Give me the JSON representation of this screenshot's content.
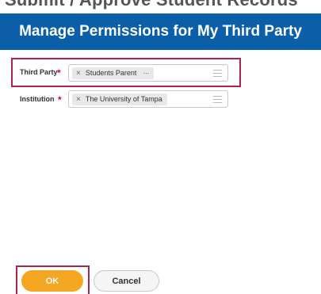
{
  "top_strip_text": "Submit / Approve Student Records",
  "header": {
    "title": "Manage Permissions for My Third Party"
  },
  "fields": [
    {
      "label": "Third Party",
      "required_mark": "*",
      "value": "Students Parent",
      "remove_glyph": "×",
      "more_glyph": "···",
      "icon": "list-icon"
    },
    {
      "label": "Institution",
      "required_mark": "*",
      "value": "The University of Tampa",
      "remove_glyph": "×",
      "icon": "list-icon"
    }
  ],
  "buttons": {
    "ok_label": "OK",
    "cancel_label": "Cancel"
  },
  "colors": {
    "header_bg": "#0a5fa8",
    "ok_bg": "#f5a623",
    "highlight": "#b0214b",
    "required": "#d6002a"
  }
}
